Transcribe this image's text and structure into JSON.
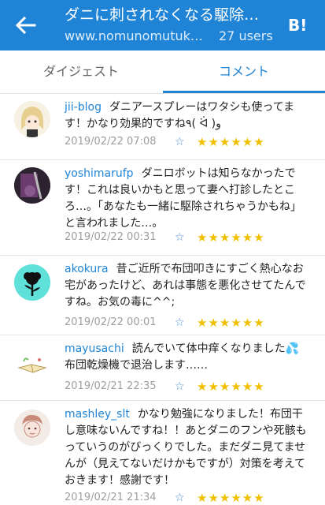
{
  "header": {
    "title": "ダニに刺されなくなる駆除…",
    "domain": "www.nomunomutuk…",
    "users": "27 users",
    "hatena_logo": "B!"
  },
  "tabs": [
    {
      "label": "ダイジェスト"
    },
    {
      "label": "コメント"
    }
  ],
  "comments": [
    {
      "user": "jii-blog",
      "text": "ダニアースプレーはワタシも使ってます！かなり効果的ですね٩( ᐛ )و",
      "date": "2019/02/22 07:08",
      "stars": "★★★★★★"
    },
    {
      "user": "yoshimarufp",
      "text": "ダニロボットは知らなかったです！これは良いかもと思って妻へ打診したところ…。「あなたも一緒に駆除されちゃうかもね」と言われました…。",
      "date": "2019/02/22 00:31",
      "stars": "★★★★★★"
    },
    {
      "user": "akokura",
      "text": "昔ご近所で布団叩きにすごく熱心なお宅があったけど、あれは事態を悪化させてたんですね。お気の毒に^^;",
      "date": "2019/02/22 00:01",
      "stars": "★★★★★★"
    },
    {
      "user": "mayusachi",
      "text": "読んでいて体中痒くなりました💦布団乾燥機で退治します……",
      "date": "2019/02/21 22:35",
      "stars": "★★★★★★"
    },
    {
      "user": "mashley_slt",
      "text": "かなり勉強になりました！布団干し意味ないんですね！！あとダニのフンや死骸もっていうのがびっくりでした。まだダニ見てませんが（見えてないだけかもですが）対策を考えておきます！感謝です！",
      "date": "2019/02/21 21:34",
      "stars": "★★★★★★"
    }
  ]
}
